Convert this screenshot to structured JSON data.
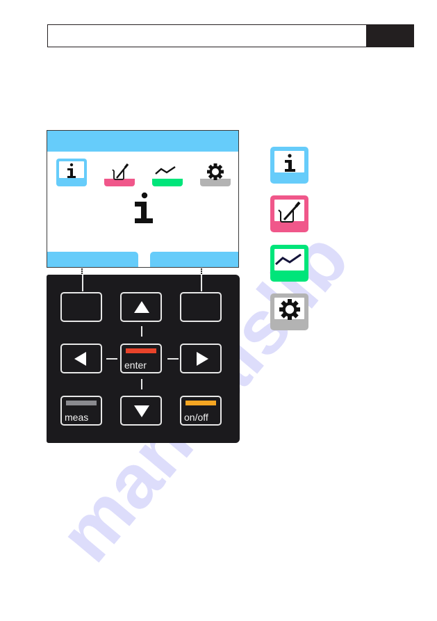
{
  "header": {
    "title": "",
    "section_tab": ""
  },
  "display": {
    "tabs": [
      {
        "name": "info",
        "icon": "info-icon",
        "color": "#66ccfa",
        "active": true
      },
      {
        "name": "calibration",
        "icon": "beaker-pipette-icon",
        "color": "#f0578a",
        "active": false
      },
      {
        "name": "data-log",
        "icon": "trend-line-icon",
        "color": "#00e57a",
        "active": false
      },
      {
        "name": "settings",
        "icon": "gear-icon",
        "color": "#b3b3b3",
        "active": false
      }
    ],
    "main_icon": "info-icon",
    "main_glyph": "i",
    "softkeys": [
      {
        "label": ""
      },
      {
        "label": ""
      }
    ]
  },
  "keypad": {
    "keys": {
      "softkey_left": "",
      "up": "▲",
      "softkey_right": "",
      "left": "◀",
      "enter": "enter",
      "right": "▶",
      "meas": "meas",
      "down": "▼",
      "onoff": "on/off"
    },
    "stripe_colors": {
      "enter": "#e8432a",
      "meas": "#8a8a8f",
      "onoff": "#f5a623"
    }
  },
  "legend": [
    {
      "name": "info",
      "icon": "info-icon",
      "color": "#66ccfa"
    },
    {
      "name": "calibration",
      "icon": "beaker-pipette-icon",
      "color": "#f0578a"
    },
    {
      "name": "data-log",
      "icon": "trend-line-icon",
      "color": "#00e57a"
    },
    {
      "name": "settings",
      "icon": "gear-icon",
      "color": "#b3b3b3"
    }
  ],
  "watermark": "manualslib"
}
